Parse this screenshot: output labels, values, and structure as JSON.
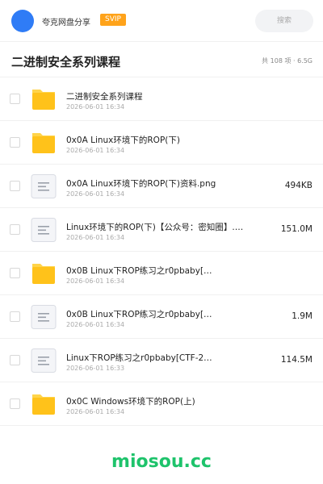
{
  "header": {
    "owner_name": "夸克网盘分享",
    "badge": "SVIP",
    "search_placeholder": "搜索"
  },
  "folder": {
    "title": "二进制安全系列课程",
    "summary": "共 108 项 · 6.5G"
  },
  "items": [
    {
      "type": "folder",
      "name": "二进制安全系列课程",
      "date": "2026-06-01 16:34",
      "size": ""
    },
    {
      "type": "folder",
      "name": "0x0A Linux环境下的ROP(下)",
      "date": "2026-06-01 16:34",
      "size": ""
    },
    {
      "type": "file",
      "name": "0x0A Linux环境下的ROP(下)资料.png",
      "date": "2026-06-01 16:34",
      "size": "494KB"
    },
    {
      "type": "file",
      "name": "Linux环境下的ROP(下)【公众号：密知圈】.…",
      "date": "2026-06-01 16:34",
      "size": "151.0M"
    },
    {
      "type": "folder",
      "name": "0x0B Linux下ROP练习之r0pbaby[…",
      "date": "2026-06-01 16:34",
      "size": ""
    },
    {
      "type": "file",
      "name": "0x0B Linux下ROP练习之r0pbaby[…",
      "date": "2026-06-01 16:34",
      "size": "1.9M"
    },
    {
      "type": "file",
      "name": "Linux下ROP练习之r0pbaby[CTF-2…",
      "date": "2026-06-01 16:33",
      "size": "114.5M"
    },
    {
      "type": "folder",
      "name": "0x0C Windows环境下的ROP(上)",
      "date": "2026-06-01 16:34",
      "size": ""
    }
  ],
  "watermark": "miosou.cc",
  "colors": {
    "accent": "#2f7cf6",
    "badge": "#ffa31a",
    "folder": "#ffc21a",
    "watermark": "#1ec36b"
  },
  "icons": {
    "folder": "folder-icon",
    "file": "document-icon"
  }
}
